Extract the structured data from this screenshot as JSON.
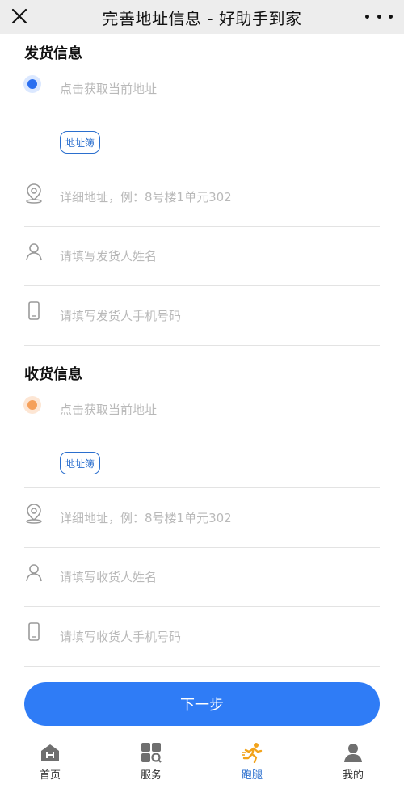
{
  "header": {
    "title": "完善地址信息 - 好助手到家"
  },
  "sender": {
    "section_title": "发货信息",
    "current_location": "点击获取当前地址",
    "address_book": "地址簿",
    "detail_placeholder": "详细地址，例：8号楼1单元302",
    "name_placeholder": "请填写发货人姓名",
    "phone_placeholder": "请填写发货人手机号码"
  },
  "receiver": {
    "section_title": "收货信息",
    "current_location": "点击获取当前地址",
    "address_book": "地址簿",
    "detail_placeholder": "详细地址，例：8号楼1单元302",
    "name_placeholder": "请填写收货人姓名",
    "phone_placeholder": "请填写收货人手机号码"
  },
  "next_button": "下一步",
  "tabs": [
    {
      "label": "首页",
      "icon": "home-icon"
    },
    {
      "label": "服务",
      "icon": "grid-icon"
    },
    {
      "label": "跑腿",
      "icon": "runner-icon",
      "active": true
    },
    {
      "label": "我的",
      "icon": "user-icon"
    }
  ],
  "colors": {
    "accent": "#2f7cf6",
    "link": "#2b6fce",
    "sender_dot": "#2b6ff0",
    "receiver_dot": "#f5a05a",
    "runner": "#f2a31b"
  }
}
